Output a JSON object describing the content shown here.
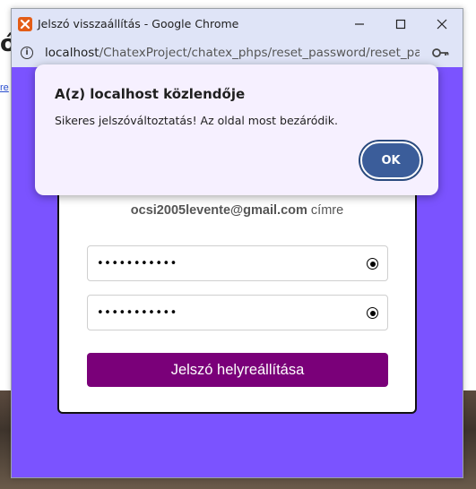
{
  "window": {
    "title": "Jelszó visszaállítás - Google Chrome"
  },
  "address_bar": {
    "host": "localhost",
    "path": "/ChatexProject/chatex_phps/reset_password/reset_passw..."
  },
  "background_page": {
    "heading_fragment": "ó",
    "link_fragment": "re"
  },
  "form": {
    "email": "ocsi2005levente@gmail.com",
    "email_suffix": " címre",
    "password1_dots": "•••••••••••",
    "password2_dots": "•••••••••••",
    "submit_label": "Jelszó helyreállítása"
  },
  "dialog": {
    "title": "A(z) localhost közlendője",
    "message": "Sikeres jelszóváltoztatás! Az oldal most bezáródik.",
    "ok_label": "OK"
  },
  "colors": {
    "page_bg": "#7b53ff",
    "submit_bg": "#7a0079",
    "ok_bg": "#3b5d9a",
    "titlebar_bg": "#dfe4f7"
  }
}
